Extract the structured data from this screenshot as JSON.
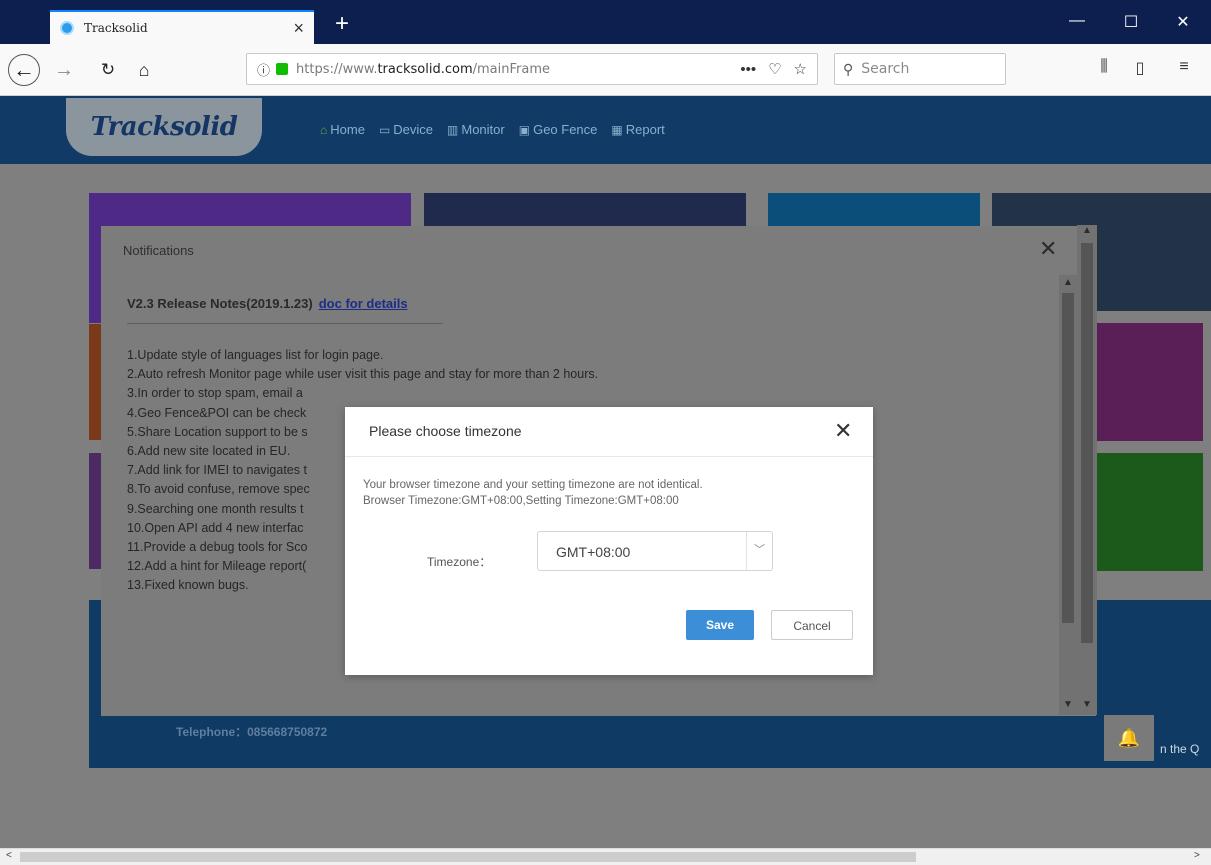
{
  "browser": {
    "tab_title": "Tracksolid",
    "tab_close": "×",
    "new_tab": "+",
    "url_prefix": "https://www.",
    "url_domain": "tracksolid.com",
    "url_path": "/mainFrame",
    "search_placeholder": "Search",
    "page_actions": "•••",
    "icons": [
      "back-icon",
      "forward-icon",
      "reload-icon",
      "home-icon",
      "info-icon",
      "lock-icon",
      "pocket-icon",
      "star-icon",
      "library-icon",
      "sidebar-icon",
      "menu-icon"
    ]
  },
  "app": {
    "logo": "Tracksolid",
    "nav": [
      {
        "label": "Home",
        "icon": "home-icon"
      },
      {
        "label": "Device",
        "icon": "device-icon"
      },
      {
        "label": "Monitor",
        "icon": "map-icon"
      },
      {
        "label": "Geo Fence",
        "icon": "geofence-icon"
      },
      {
        "label": "Report",
        "icon": "report-icon"
      }
    ],
    "telephone": "Telephone：085668750872",
    "qr_text": "n the Q"
  },
  "notifications": {
    "title": "Notifications",
    "release_title": "V2.3 Release Notes(2019.1.23)",
    "doc_link": "doc for details",
    "notes": [
      "1.Update style of languages list for login page.",
      "2.Auto refresh Monitor page while user visit this page and stay for more than 2 hours.",
      "3.In order to stop spam, email a",
      "4.Geo Fence&POI can be check",
      "5.Share Location support to be s",
      "6.Add new site located in EU.",
      "7.Add link for IMEI to navigates t",
      "8.To avoid confuse, remove spec",
      "9.Searching one month results t",
      "10.Open API add 4 new interfac",
      "11.Provide a debug tools for Sco",
      "12.Add a hint for Mileage report(",
      "13.Fixed known bugs."
    ]
  },
  "timezone_dialog": {
    "title": "Please choose timezone",
    "message_line1": "Your browser timezone and your setting timezone are not identical.",
    "message_line2": "Browser Timezone:GMT+08:00,Setting Timezone:GMT+08:00",
    "label": "Timezone：",
    "selected": "GMT+08:00",
    "save": "Save",
    "cancel": "Cancel"
  },
  "colors": {
    "tile_purple": "#4e2a86",
    "tile_navy": "#1f2a4d",
    "tile_cyan": "#0c4e7a",
    "tile_steel": "#223247",
    "tile_orange": "#7a3a1a",
    "tile_magenta": "#5a1f57",
    "tile_green": "#1b5a1b",
    "tile_blue": "#0f3a64",
    "save_button": "#3c8fd6"
  }
}
